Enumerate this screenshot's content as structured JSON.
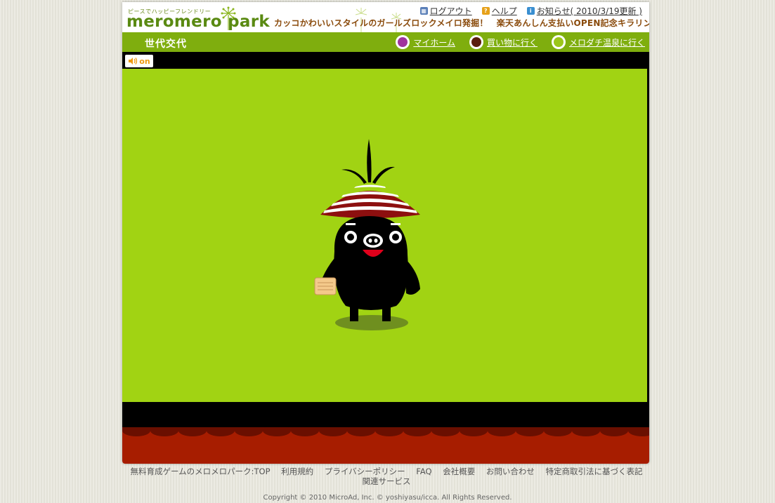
{
  "header": {
    "tagline": "ピースでハッピーフレンドリー",
    "logo": "meromero park",
    "headline": "カッコかわいいスタイルのガールズロックメイロ発掘！　楽天あんしん支払いOPEN記念キラリン増量中!",
    "links": [
      {
        "label": "ログアウト",
        "icon": "logout-icon",
        "color": "#5a7fb8"
      },
      {
        "label": "ヘルプ",
        "icon": "help-icon",
        "color": "#e6a11a"
      },
      {
        "label": "お知らせ( 2010/3/19更新 )",
        "icon": "info-icon",
        "color": "#3a8fd1"
      }
    ]
  },
  "nav": {
    "title": "世代交代",
    "links": [
      {
        "label": "マイホーム",
        "icon": "my-home-icon",
        "color": "#a0339d"
      },
      {
        "label": "買い物に行く",
        "icon": "shopping-icon",
        "color": "#5a1e0e"
      },
      {
        "label": "メロダチ温泉に行く",
        "icon": "hot-spring-icon",
        "color": "#9bc61a"
      }
    ]
  },
  "stage": {
    "sound_label": "on",
    "background": "#a1d313",
    "curtain_color": "#a71d00"
  },
  "footer": {
    "links": [
      "無料育成ゲームのメロメロパーク:TOP",
      "利用規約",
      "プライバシーポリシー",
      "FAQ",
      "会社概要",
      "お問い合わせ",
      "特定商取引法に基づく表記",
      "関連サービス"
    ],
    "copyright": "Copyright © 2010 MicroAd, Inc. © yoshiyasu/icca. All Rights Reserved."
  }
}
